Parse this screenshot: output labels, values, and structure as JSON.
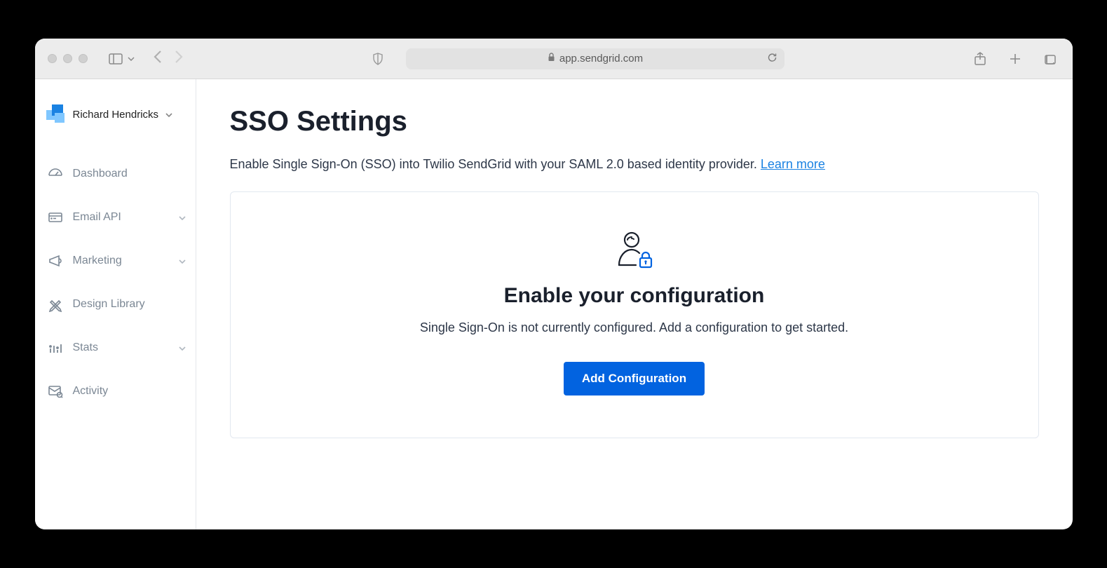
{
  "browser": {
    "url_display": "app.sendgrid.com"
  },
  "sidebar": {
    "user_name": "Richard Hendricks",
    "items": [
      {
        "label": "Dashboard",
        "expandable": false
      },
      {
        "label": "Email API",
        "expandable": true
      },
      {
        "label": "Marketing",
        "expandable": true
      },
      {
        "label": "Design Library",
        "expandable": false
      },
      {
        "label": "Stats",
        "expandable": true
      },
      {
        "label": "Activity",
        "expandable": false
      }
    ]
  },
  "main": {
    "title": "SSO Settings",
    "description": "Enable Single Sign-On (SSO) into Twilio SendGrid with your SAML 2.0 based identity provider. ",
    "learn_more": "Learn more",
    "card": {
      "title": "Enable your configuration",
      "description": "Single Sign-On is not currently configured. Add a configuration to get started.",
      "button": "Add Configuration"
    }
  }
}
